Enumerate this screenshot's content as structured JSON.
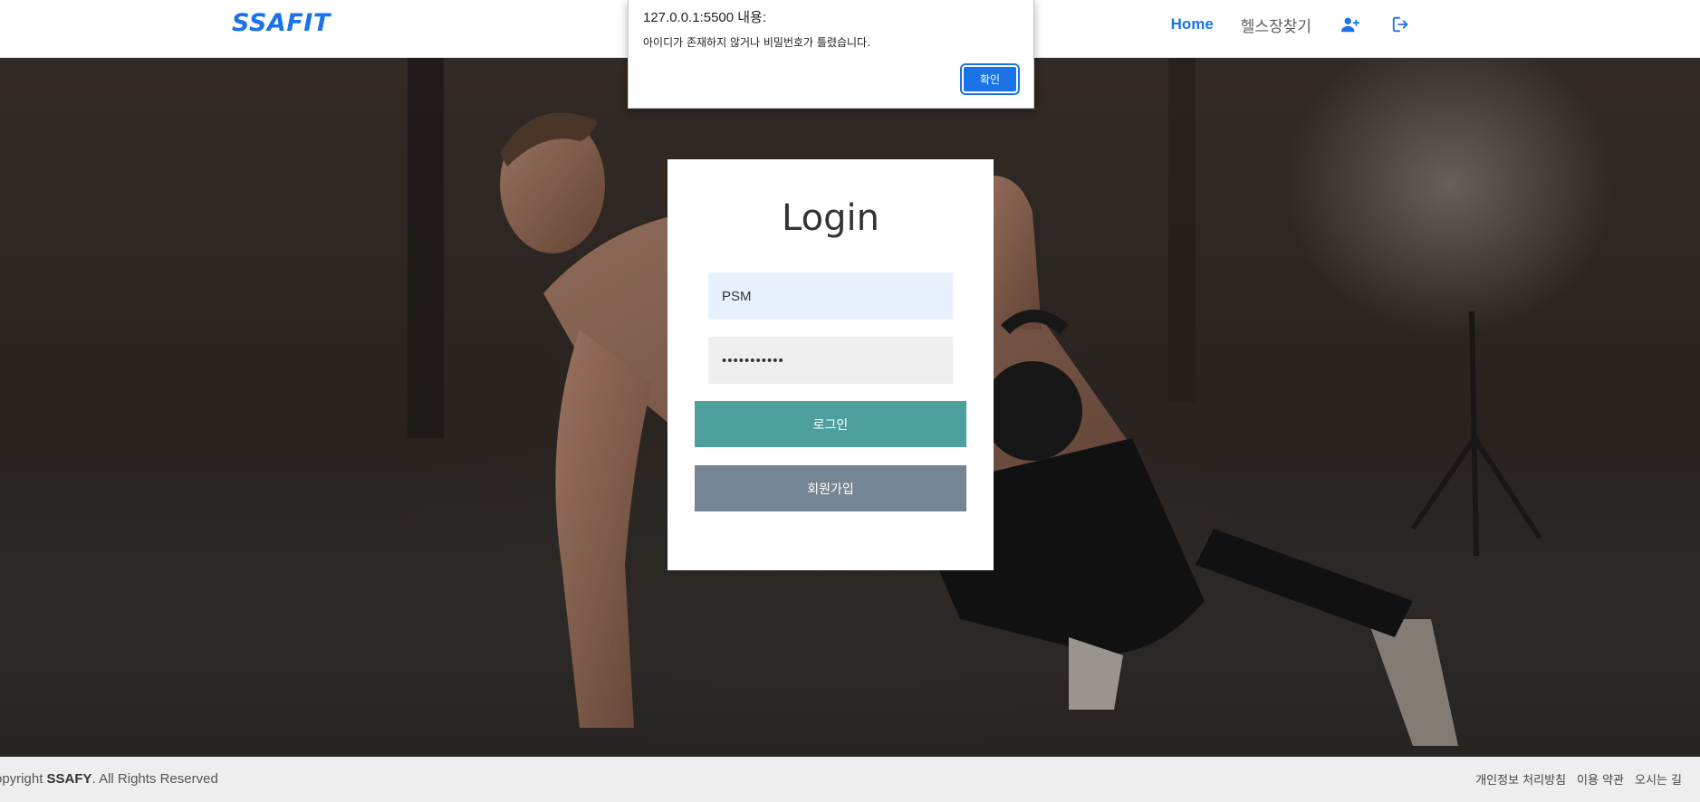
{
  "header": {
    "brand": "SSAFIT",
    "nav": [
      {
        "label": "Home",
        "active": true
      },
      {
        "label": "헬스장찾기",
        "active": false
      }
    ],
    "icons": [
      "user-plus-icon",
      "logout-icon"
    ],
    "accent_color": "#1a73e8"
  },
  "alert": {
    "origin": "127.0.0.1:5500 내용:",
    "message": "아이디가 존재하지 않거나 비밀번호가 틀렸습니다.",
    "ok_label": "확인"
  },
  "login": {
    "title": "Login",
    "id_value": "PSM",
    "password_value": "•••••••••••",
    "login_label": "로그인",
    "signup_label": "회원가입",
    "login_color": "#4ea09d",
    "signup_color": "#768594"
  },
  "footer": {
    "copy_prefix": "opyright ",
    "copy_brand": "SSAFY",
    "copy_suffix": ". All Rights Reserved",
    "links": [
      "개인정보 처리방침",
      "이용 약관",
      "오시는 길"
    ]
  }
}
